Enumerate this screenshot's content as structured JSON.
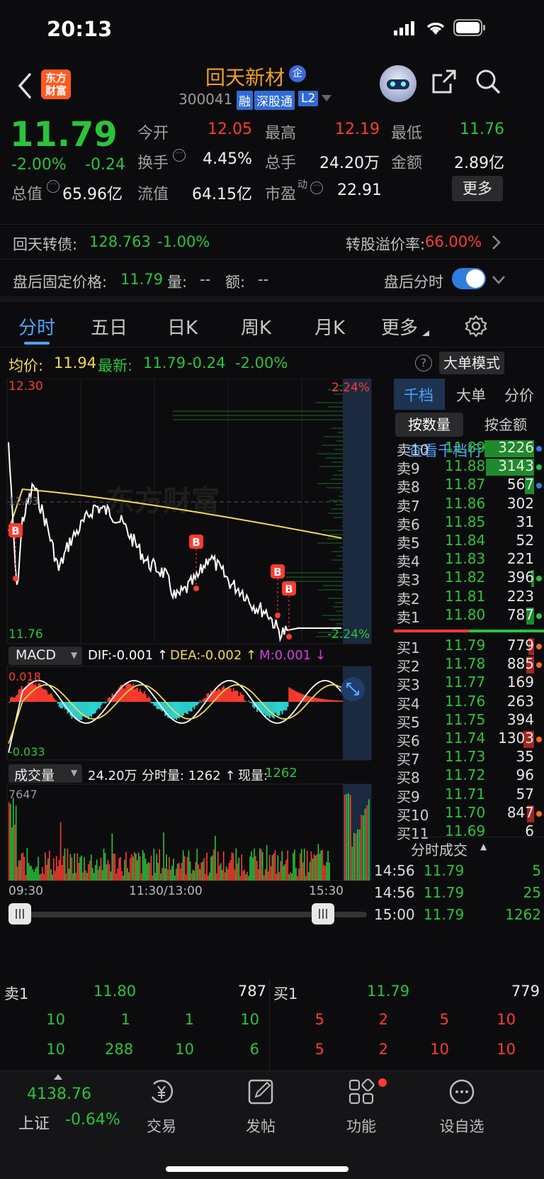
{
  "status": {
    "time": "20:13"
  },
  "nav": {
    "logo_line1": "东方",
    "logo_line2": "财富",
    "stock_name": "回天新材",
    "enterprise_badge": "企",
    "stock_code": "300041",
    "tag_margin": "融",
    "tag_connect": "深股通",
    "tag_level": "L2"
  },
  "quote": {
    "price": "11.79",
    "change_pct": "-2.00%",
    "change": "-0.24",
    "open_label": "今开",
    "open": "12.05",
    "high_label": "最高",
    "high": "12.19",
    "low_label": "最低",
    "low": "11.76",
    "turnover_label": "换手",
    "turnover": "4.45%",
    "volume_label": "总手",
    "volume": "24.20万",
    "amount_label": "金额",
    "amount": "2.89亿",
    "mktcap_label": "总值",
    "mktcap": "65.96亿",
    "float_label": "流值",
    "float": "64.15亿",
    "pe_label": "市盈",
    "pe_sup": "动",
    "pe": "22.91",
    "more_button": "更多"
  },
  "convertible": {
    "name": "回天转债:",
    "price": "128.763",
    "change": "-1.00%",
    "premium_label": "转股溢价率:",
    "premium": "66.00%"
  },
  "afterhours": {
    "price_label": "盘后固定价格:",
    "price": "11.79",
    "vol_label": "量:",
    "vol": "--",
    "amt_label": "额:",
    "amt": "--",
    "toggle_label": "盘后分时"
  },
  "tabs": [
    "分时",
    "五日",
    "日K",
    "周K",
    "月K",
    "更多"
  ],
  "chart_header": {
    "avg_label": "均价:",
    "avg": "11.94",
    "latest_label": "最新:",
    "latest": "11.79",
    "chg": "-0.24",
    "pct": "-2.00%",
    "bigorder_button": "大单模式"
  },
  "main_chart": {
    "max_price": "12.30",
    "min_price": "11.76",
    "max_pct": "2.24%",
    "min_pct": "-2.24%",
    "ref_price": "12.03",
    "marker": "B",
    "watermark": "东方财富"
  },
  "macd": {
    "selector": "MACD",
    "dif": "DIF:-0.001 ↑",
    "dea": "DEA:-0.002 ↑",
    "m": "M:0.001 ↓",
    "max": "0.018",
    "min": "-0.033"
  },
  "volume_panel": {
    "selector": "成交量",
    "total": "24.20万",
    "bar_label": "分时量: 1262 ↑",
    "now_label": "现量:",
    "now": "1262",
    "max": "7647"
  },
  "time_axis": [
    "09:30",
    "11:30/13:00",
    "15:30"
  ],
  "book": {
    "tabs": [
      "千档",
      "大单",
      "分价"
    ],
    "mode_qty": "按数量",
    "mode_amt": "按金额",
    "link": "查看千档行情 >",
    "asks": [
      {
        "label": "卖10",
        "price": "11.89",
        "vol": "3226",
        "fill": 1.0
      },
      {
        "label": "卖9",
        "price": "11.88",
        "vol": "3143",
        "fill": 0.97
      },
      {
        "label": "卖8",
        "price": "11.87",
        "vol": "567",
        "fill": 0.18
      },
      {
        "label": "卖7",
        "price": "11.86",
        "vol": "302",
        "fill": 0.0
      },
      {
        "label": "卖6",
        "price": "11.85",
        "vol": "31",
        "fill": 0.0
      },
      {
        "label": "卖5",
        "price": "11.84",
        "vol": "52",
        "fill": 0.0
      },
      {
        "label": "卖4",
        "price": "11.83",
        "vol": "221",
        "fill": 0.0
      },
      {
        "label": "卖3",
        "price": "11.82",
        "vol": "396",
        "fill": 0.05
      },
      {
        "label": "卖2",
        "price": "11.81",
        "vol": "223",
        "fill": 0.0
      },
      {
        "label": "卖1",
        "price": "11.80",
        "vol": "787",
        "fill": 0.15
      }
    ],
    "bids": [
      {
        "label": "买1",
        "price": "11.79",
        "vol": "779",
        "fill": 0.12
      },
      {
        "label": "买2",
        "price": "11.78",
        "vol": "885",
        "fill": 0.15
      },
      {
        "label": "买3",
        "price": "11.77",
        "vol": "169",
        "fill": 0.0
      },
      {
        "label": "买4",
        "price": "11.76",
        "vol": "263",
        "fill": 0.0
      },
      {
        "label": "买5",
        "price": "11.75",
        "vol": "394",
        "fill": 0.0
      },
      {
        "label": "买6",
        "price": "11.74",
        "vol": "1303",
        "fill": 0.22
      },
      {
        "label": "买7",
        "price": "11.73",
        "vol": "35",
        "fill": 0.0
      },
      {
        "label": "买8",
        "price": "11.72",
        "vol": "96",
        "fill": 0.0
      },
      {
        "label": "买9",
        "price": "11.71",
        "vol": "57",
        "fill": 0.0
      },
      {
        "label": "买10",
        "price": "11.70",
        "vol": "847",
        "fill": 0.14
      },
      {
        "label": "买11",
        "price": "11.69",
        "vol": "6",
        "fill": 0.0
      }
    ],
    "ticks_header": "分时成交",
    "ticks": [
      {
        "time": "14:56",
        "price": "11.79",
        "vol": "5"
      },
      {
        "time": "14:56",
        "price": "11.79",
        "vol": "25"
      },
      {
        "time": "15:00",
        "price": "11.79",
        "vol": "1262"
      }
    ]
  },
  "bottom_quote": {
    "ask_label": "卖1",
    "ask_price": "11.80",
    "ask_vol": "787",
    "bid_label": "买1",
    "bid_price": "11.79",
    "bid_vol": "779",
    "ask_rows": [
      [
        "10",
        "1",
        "1",
        "10"
      ],
      [
        "10",
        "288",
        "10",
        "6"
      ]
    ],
    "bid_rows": [
      [
        "5",
        "2",
        "5",
        "10"
      ],
      [
        "5",
        "2",
        "10",
        "10"
      ]
    ]
  },
  "tabbar": {
    "index_value": "4138.76",
    "index_name": "上证",
    "index_pct": "-0.64%",
    "items": [
      "交易",
      "发帖",
      "功能",
      "设自选"
    ]
  },
  "colors": {
    "up": "#ff3b30",
    "down": "#29c43a",
    "avg_line": "#f2d94e",
    "accent": "#2f7de1",
    "price_line": "#ffffff"
  }
}
